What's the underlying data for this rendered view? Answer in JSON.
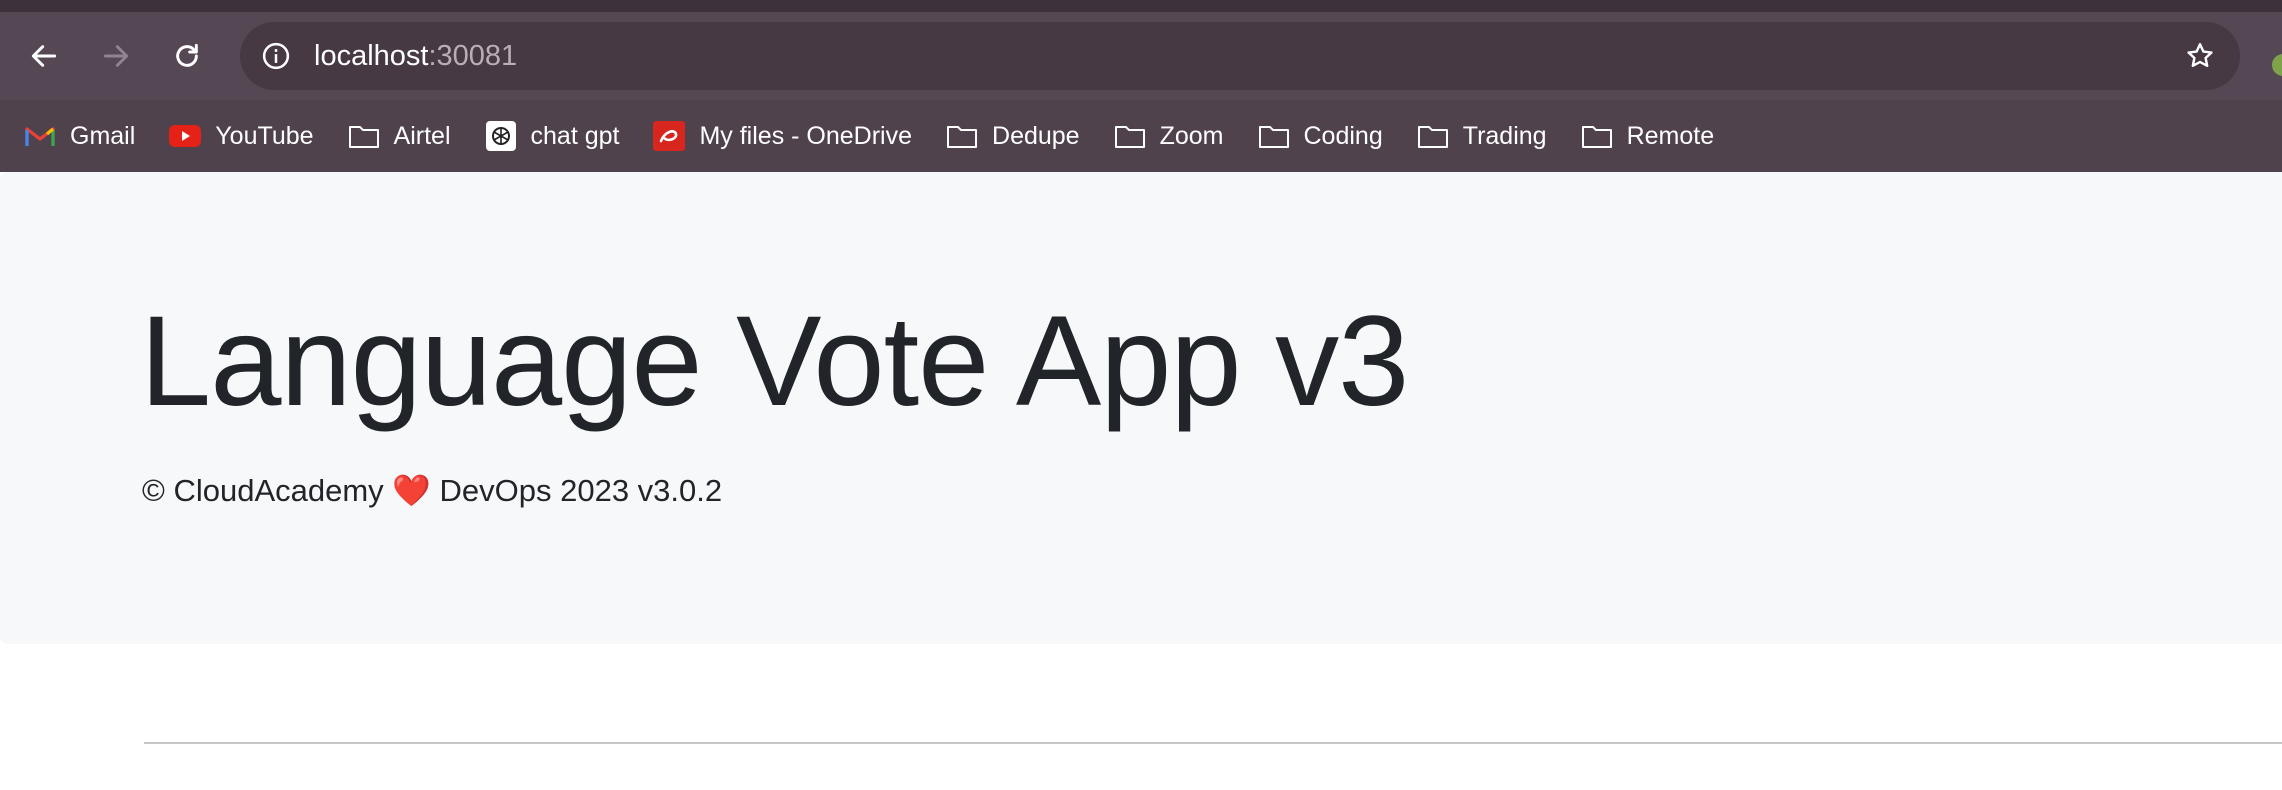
{
  "browser": {
    "url_host": "localhost",
    "url_port": ":30081",
    "bookmarks": [
      {
        "label": "Gmail",
        "icon": "gmail-icon"
      },
      {
        "label": "YouTube",
        "icon": "youtube-icon"
      },
      {
        "label": "Airtel",
        "icon": "folder-icon"
      },
      {
        "label": "chat gpt",
        "icon": "chatgpt-icon"
      },
      {
        "label": "My files - OneDrive",
        "icon": "airtel-icon"
      },
      {
        "label": "Dedupe",
        "icon": "folder-icon"
      },
      {
        "label": "Zoom",
        "icon": "folder-icon"
      },
      {
        "label": "Coding",
        "icon": "folder-icon"
      },
      {
        "label": "Trading",
        "icon": "folder-icon"
      },
      {
        "label": "Remote",
        "icon": "folder-icon"
      }
    ]
  },
  "page": {
    "title": "Language Vote App v3",
    "subtitle": "© CloudAcademy ❤️ DevOps 2023 v3.0.2"
  },
  "colors": {
    "chrome_bg": "#554753",
    "omnibox_bg": "#463944",
    "jumbotron_bg": "#f7f8fa",
    "text": "#212529",
    "youtube_red": "#e62117",
    "airtel_red": "#d7261e"
  }
}
